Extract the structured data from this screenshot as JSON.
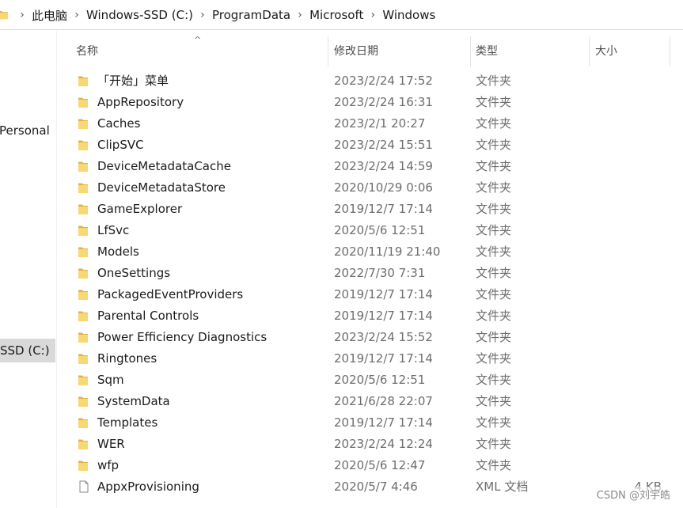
{
  "breadcrumb": {
    "items": [
      "此电脑",
      "Windows-SSD (C:)",
      "ProgramData",
      "Microsoft",
      "Windows"
    ]
  },
  "nav": {
    "personal": "Personal",
    "drive": "SSD (C:)"
  },
  "columns": {
    "name": "名称",
    "date": "修改日期",
    "type": "类型",
    "size": "大小"
  },
  "files": [
    {
      "name": "「开始」菜单",
      "date": "2023/2/24 17:52",
      "type": "文件夹",
      "size": "",
      "icon": "folder-icon"
    },
    {
      "name": "AppRepository",
      "date": "2023/2/24 16:31",
      "type": "文件夹",
      "size": "",
      "icon": "folder-icon"
    },
    {
      "name": "Caches",
      "date": "2023/2/1 20:27",
      "type": "文件夹",
      "size": "",
      "icon": "folder-icon"
    },
    {
      "name": "ClipSVC",
      "date": "2023/2/24 15:51",
      "type": "文件夹",
      "size": "",
      "icon": "folder-icon"
    },
    {
      "name": "DeviceMetadataCache",
      "date": "2023/2/24 14:59",
      "type": "文件夹",
      "size": "",
      "icon": "folder-icon"
    },
    {
      "name": "DeviceMetadataStore",
      "date": "2020/10/29 0:06",
      "type": "文件夹",
      "size": "",
      "icon": "folder-icon"
    },
    {
      "name": "GameExplorer",
      "date": "2019/12/7 17:14",
      "type": "文件夹",
      "size": "",
      "icon": "folder-icon"
    },
    {
      "name": "LfSvc",
      "date": "2020/5/6 12:51",
      "type": "文件夹",
      "size": "",
      "icon": "folder-icon"
    },
    {
      "name": "Models",
      "date": "2020/11/19 21:40",
      "type": "文件夹",
      "size": "",
      "icon": "folder-icon"
    },
    {
      "name": "OneSettings",
      "date": "2022/7/30 7:31",
      "type": "文件夹",
      "size": "",
      "icon": "folder-icon"
    },
    {
      "name": "PackagedEventProviders",
      "date": "2019/12/7 17:14",
      "type": "文件夹",
      "size": "",
      "icon": "folder-icon"
    },
    {
      "name": "Parental Controls",
      "date": "2019/12/7 17:14",
      "type": "文件夹",
      "size": "",
      "icon": "folder-icon"
    },
    {
      "name": "Power Efficiency Diagnostics",
      "date": "2023/2/24 15:52",
      "type": "文件夹",
      "size": "",
      "icon": "folder-icon"
    },
    {
      "name": "Ringtones",
      "date": "2019/12/7 17:14",
      "type": "文件夹",
      "size": "",
      "icon": "folder-icon"
    },
    {
      "name": "Sqm",
      "date": "2020/5/6 12:51",
      "type": "文件夹",
      "size": "",
      "icon": "folder-icon"
    },
    {
      "name": "SystemData",
      "date": "2021/6/28 22:07",
      "type": "文件夹",
      "size": "",
      "icon": "folder-icon"
    },
    {
      "name": "Templates",
      "date": "2019/12/7 17:14",
      "type": "文件夹",
      "size": "",
      "icon": "folder-icon"
    },
    {
      "name": "WER",
      "date": "2023/2/24 12:24",
      "type": "文件夹",
      "size": "",
      "icon": "folder-icon"
    },
    {
      "name": "wfp",
      "date": "2020/5/6 12:47",
      "type": "文件夹",
      "size": "",
      "icon": "folder-icon"
    },
    {
      "name": "AppxProvisioning",
      "date": "2020/5/7 4:46",
      "type": "XML 文档",
      "size": "4 KB",
      "icon": "file-icon"
    }
  ],
  "watermark": "CSDN @刘宇皓",
  "colors": {
    "folder": "#F8D775",
    "folder_dark": "#E3B340",
    "selected_nav": "#D9D9D9"
  }
}
